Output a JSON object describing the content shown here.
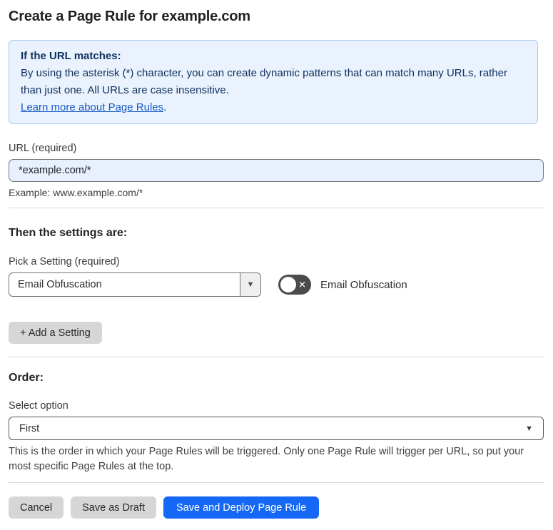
{
  "page": {
    "title": "Create a Page Rule for example.com"
  },
  "info_box": {
    "heading": "If the URL matches:",
    "body": "By using the asterisk (*) character, you can create dynamic patterns that can match many URLs, rather than just one. All URLs are case insensitive.",
    "link_label": "Learn more about Page Rules",
    "link_suffix": "."
  },
  "url_field": {
    "label": "URL (required)",
    "value": "*example.com/*",
    "example": "Example: www.example.com/*"
  },
  "settings_section": {
    "heading": "Then the settings are:",
    "picker_label": "Pick a Setting (required)",
    "picker_value": "Email Obfuscation",
    "toggle_label": "Email Obfuscation",
    "toggle_state": "off",
    "add_setting_label": "+ Add a Setting"
  },
  "order_section": {
    "heading": "Order:",
    "select_label": "Select option",
    "select_value": "First",
    "help_text": "This is the order in which your Page Rules will be triggered. Only one Page Rule will trigger per URL, so put your most specific Page Rules at the top."
  },
  "footer": {
    "cancel_label": "Cancel",
    "save_draft_label": "Save as Draft",
    "save_deploy_label": "Save and Deploy Page Rule"
  },
  "icons": {
    "dropdown_arrow": "▼",
    "toggle_off_x": "✕"
  },
  "colors": {
    "info_bg": "#e9f2fd",
    "info_border": "#a9c9f5",
    "info_text": "#10305f",
    "link_blue": "#1a5bc5",
    "input_autofill_bg": "#e8f0fe",
    "primary_button_blue": "#1468f5",
    "toggle_off_gray": "#4b4b4d",
    "secondary_button_gray": "#d6d6d6"
  }
}
